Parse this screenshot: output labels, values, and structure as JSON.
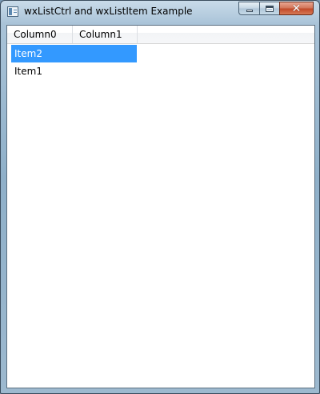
{
  "window": {
    "title": "wxListCtrl and wxListItem Example",
    "caption_buttons": {
      "minimize_glyph": "minimize-icon",
      "maximize_glyph": "maximize-icon",
      "close_glyph": "✕"
    }
  },
  "list": {
    "columns": [
      {
        "label": "Column0"
      },
      {
        "label": "Column1"
      }
    ],
    "rows": [
      {
        "col0": "Item2",
        "col1": "",
        "selected": true
      },
      {
        "col0": "Item1",
        "col1": "",
        "selected": false
      }
    ],
    "selection_color": "#3399ff"
  }
}
